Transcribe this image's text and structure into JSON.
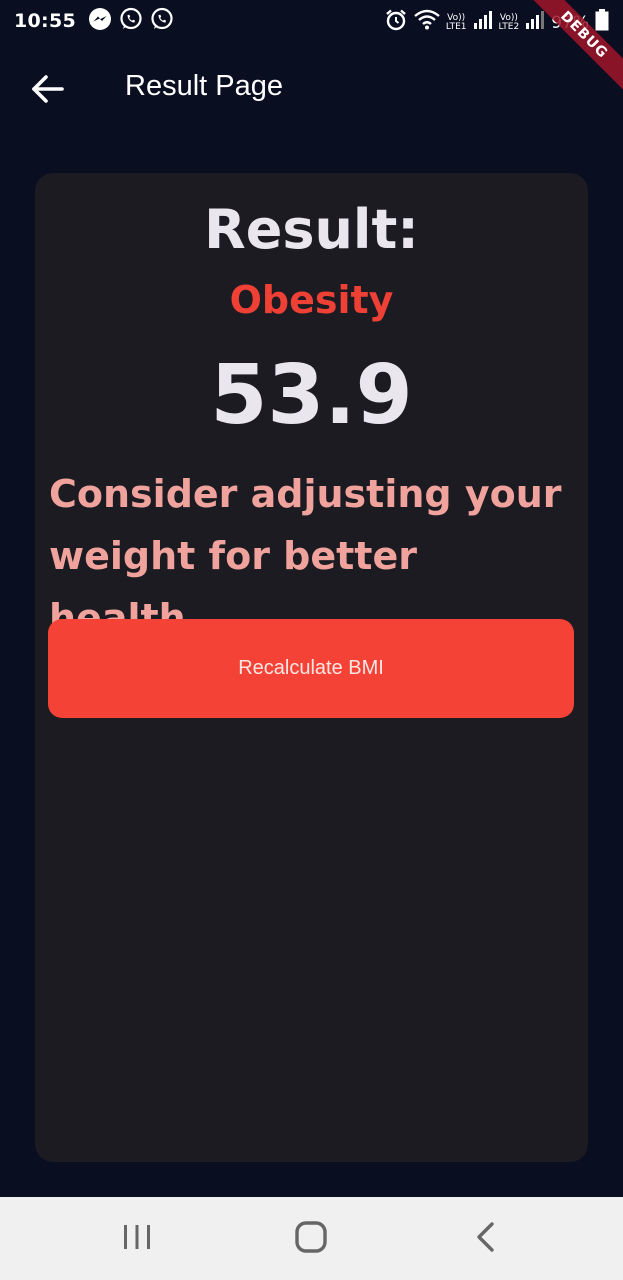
{
  "status_bar": {
    "time": "10:55",
    "left_icons": [
      "messenger-icon",
      "whatsapp-icon",
      "whatsapp-icon"
    ],
    "lte1_top": "Vo))",
    "lte1_bottom": "LTE1",
    "lte2_top": "Vo))",
    "lte2_bottom": "LTE2",
    "battery_percent": "97%"
  },
  "debug_banner": "DEBUG",
  "app_bar": {
    "title": "Result Page",
    "back_icon": "arrow-left-icon"
  },
  "result": {
    "heading": "Result:",
    "status": "Obesity",
    "bmi": "53.9",
    "advice": "Consider adjusting your weight for better health.",
    "button_label": "Recalculate BMI"
  },
  "colors": {
    "background": "#0a0e21",
    "card": "#1d1b22",
    "status_red": "#ee4035",
    "advice_pink": "#f0a29c",
    "button_red": "#f44336"
  },
  "nav_bar": {
    "icons": [
      "recent-apps-icon",
      "home-icon",
      "back-icon"
    ]
  }
}
